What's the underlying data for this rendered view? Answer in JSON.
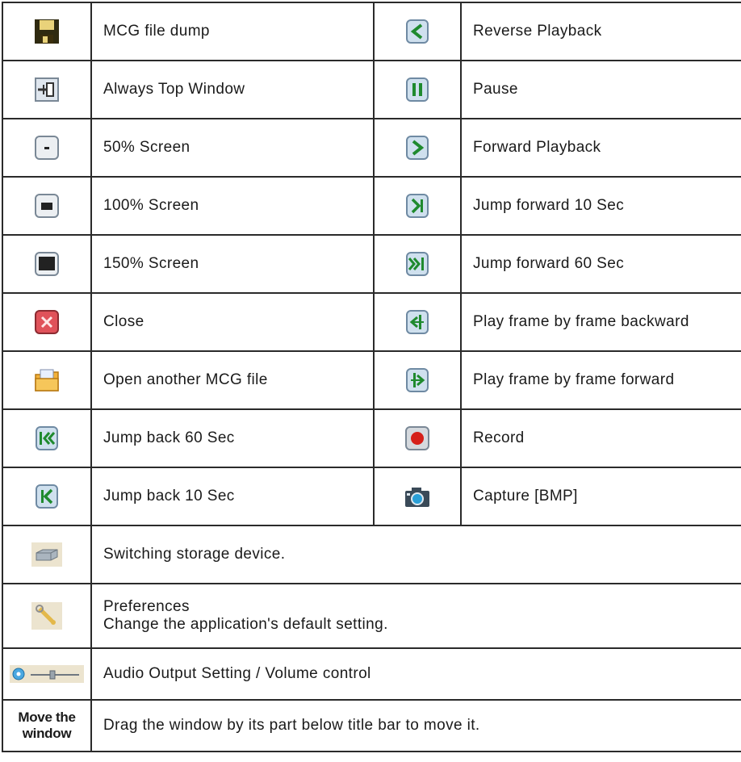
{
  "rows": [
    {
      "left": {
        "icon": "floppy-disk-icon",
        "label": "MCG file dump"
      },
      "right": {
        "icon": "reverse-playback-icon",
        "label": "Reverse Playback"
      }
    },
    {
      "left": {
        "icon": "pin-icon",
        "label": "Always Top Window"
      },
      "right": {
        "icon": "pause-icon",
        "label": "Pause"
      }
    },
    {
      "left": {
        "icon": "screen-50-icon",
        "label": "50% Screen"
      },
      "right": {
        "icon": "forward-playback-icon",
        "label": "Forward Playback"
      }
    },
    {
      "left": {
        "icon": "screen-100-icon",
        "label": "100% Screen"
      },
      "right": {
        "icon": "jump-forward-10-icon",
        "label": "Jump forward 10 Sec"
      }
    },
    {
      "left": {
        "icon": "screen-150-icon",
        "label": "150% Screen"
      },
      "right": {
        "icon": "jump-forward-60-icon",
        "label": "Jump forward 60 Sec"
      }
    },
    {
      "left": {
        "icon": "close-icon",
        "label": "Close"
      },
      "right": {
        "icon": "frame-backward-icon",
        "label": "Play frame by frame backward"
      }
    },
    {
      "left": {
        "icon": "open-folder-icon",
        "label": "Open another MCG file"
      },
      "right": {
        "icon": "frame-forward-icon",
        "label": "Play frame by frame forward"
      }
    },
    {
      "left": {
        "icon": "jump-back-60-icon",
        "label": "Jump back 60 Sec"
      },
      "right": {
        "icon": "record-icon",
        "label": "Record"
      }
    },
    {
      "left": {
        "icon": "jump-back-10-icon",
        "label": "Jump back 10 Sec"
      },
      "right": {
        "icon": "camera-icon",
        "label": "Capture [BMP]"
      }
    }
  ],
  "wide_rows": [
    {
      "icon": "storage-device-icon",
      "label": "Switching storage device."
    },
    {
      "icon": "wrench-icon",
      "title": "Preferences",
      "description": "Change the application's default setting."
    },
    {
      "icon": "volume-slider-icon",
      "label": "Audio Output Setting / Volume control"
    },
    {
      "label_line1": "Move the",
      "label_line2": "window",
      "description": "Drag the window by its part below title bar to move it."
    }
  ]
}
